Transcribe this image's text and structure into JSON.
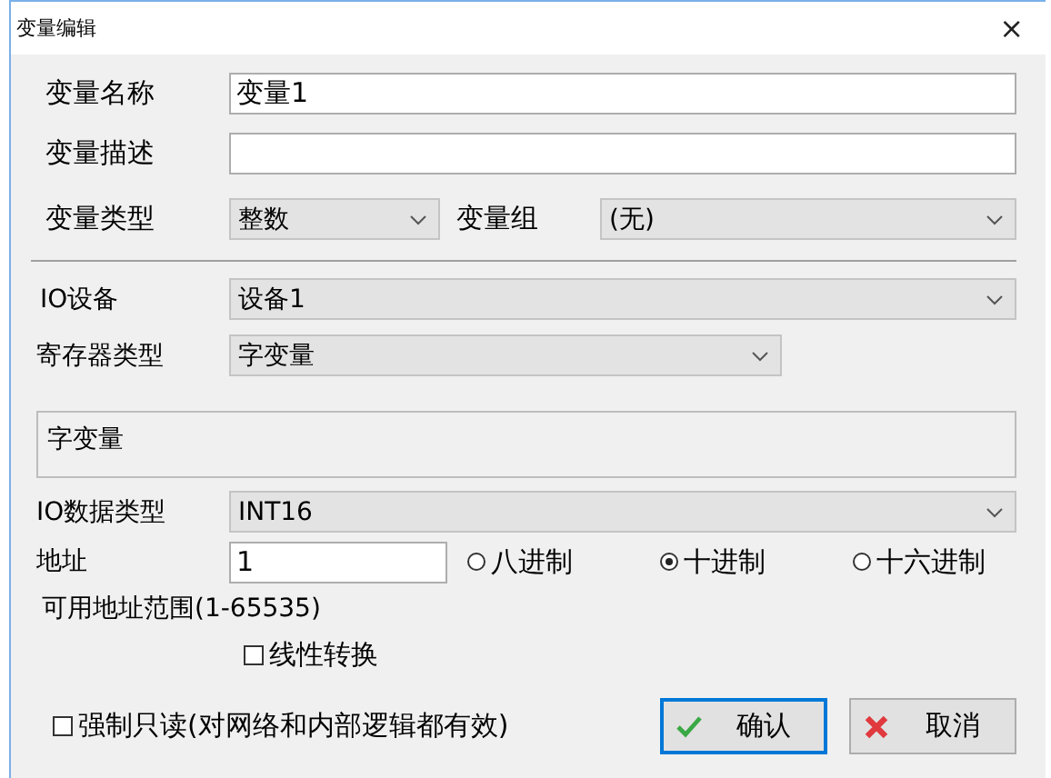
{
  "window": {
    "title": "变量编辑",
    "close": "×"
  },
  "name": {
    "label": "变量名称",
    "value": "变量1"
  },
  "description": {
    "label": "变量描述"
  },
  "type": {
    "label": "变量类型",
    "value": "整数",
    "group_label": "变量组",
    "group_value": "(无)"
  },
  "io_device": {
    "label": "IO设备",
    "value": "设备1"
  },
  "register_type": {
    "label": "寄存器类型",
    "value": "字变量"
  },
  "register_info": "字变量",
  "io_data_type": {
    "label": "IO数据类型",
    "value": "INT16"
  },
  "address": {
    "label": "地址",
    "value": "1"
  },
  "radix": [
    {
      "label": "八进制",
      "selected": false
    },
    {
      "label": "十进制",
      "selected": true
    },
    {
      "label": "十六进制",
      "selected": false
    }
  ],
  "range": "可用地址范围(1-65535)",
  "linear": {
    "label": "线性转换",
    "checked": false
  },
  "readonly": {
    "label": "强制只读(对网络和内部逻辑都有效)",
    "checked": false
  },
  "buttons": [
    {
      "kind": "ok",
      "label": "确认",
      "focused": true
    },
    {
      "kind": "cancel",
      "label": "取消",
      "focused": false
    }
  ]
}
